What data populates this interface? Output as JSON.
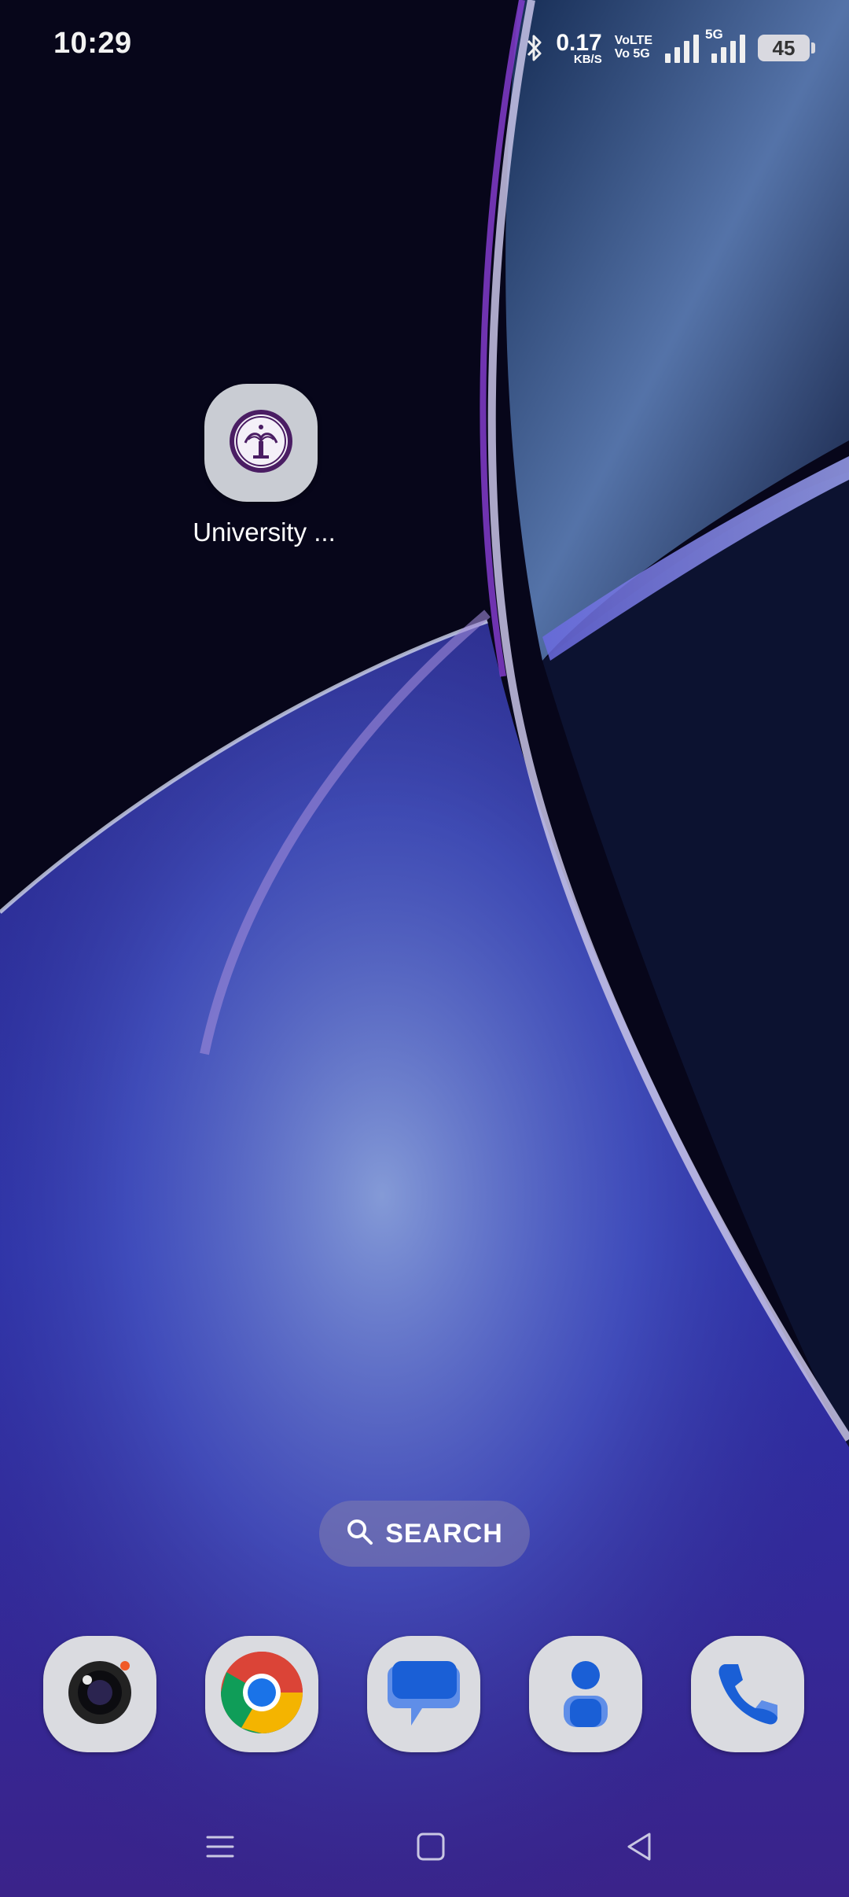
{
  "status_bar": {
    "time": "10:29",
    "net_speed_value": "0.17",
    "net_speed_unit": "KB/S",
    "volte_1": "VoLTE",
    "volte_2": "Vo 5G",
    "network_type": "5G",
    "battery_level": "45",
    "icons": [
      "bluetooth-icon",
      "signal-sim1-icon",
      "signal-sim2-icon",
      "battery-icon"
    ]
  },
  "home": {
    "apps": [
      {
        "label": "University ...",
        "icon": "university-logo-icon"
      }
    ]
  },
  "search": {
    "label": "SEARCH",
    "icon": "search-icon"
  },
  "dock": {
    "apps": [
      {
        "icon": "camera-icon"
      },
      {
        "icon": "chrome-icon"
      },
      {
        "icon": "messages-icon"
      },
      {
        "icon": "contacts-icon"
      },
      {
        "icon": "phone-icon"
      }
    ]
  },
  "nav_bar": {
    "buttons": [
      "recents-menu-icon",
      "home-square-icon",
      "back-triangle-icon"
    ]
  },
  "colors": {
    "accent": "#1a73e8",
    "search_pill": "#827daf",
    "dock_tile": "#dadbe0"
  }
}
